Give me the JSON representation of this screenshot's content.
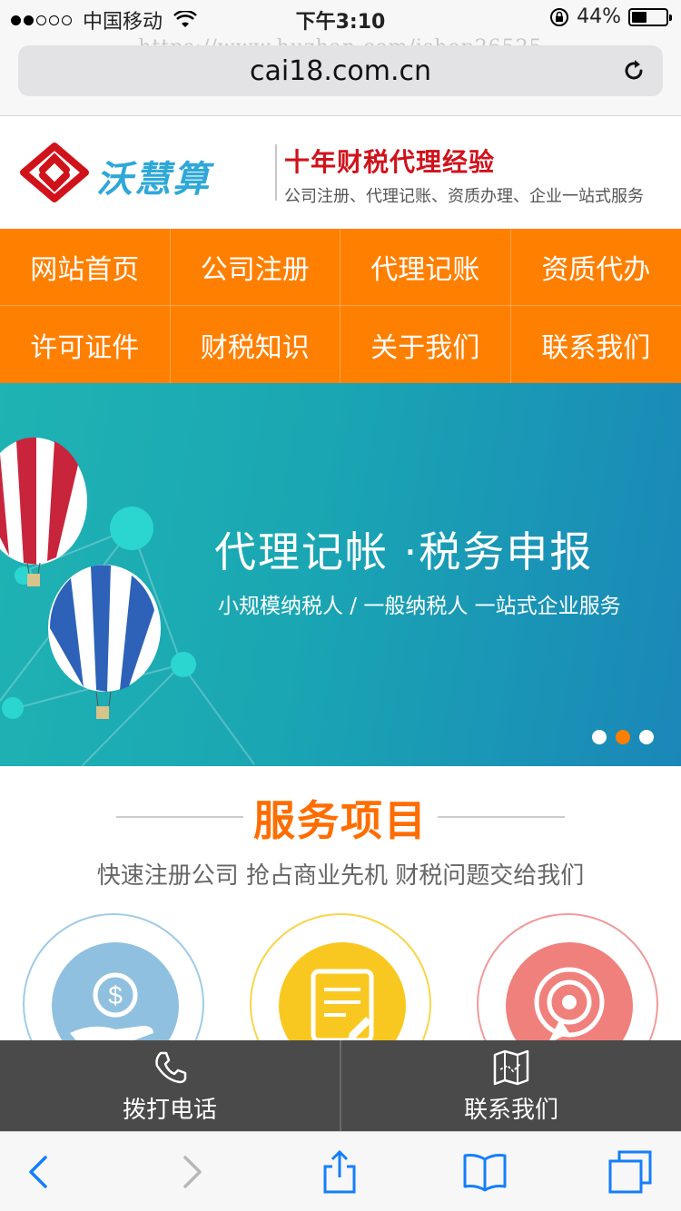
{
  "status_bar": {
    "carrier": "中国移动",
    "time": "下午3:10",
    "battery_percent": "44%",
    "battery_level": 0.44,
    "signal_dots_filled": 2,
    "signal_dots_total": 5
  },
  "browser": {
    "watermark": "https://www.huzhan.com/ishop26525",
    "url": "cai18.com.cn"
  },
  "header": {
    "logo_text": "沃慧算",
    "slogan": "十年财税代理经验",
    "services_line": "公司注册、代理记账、资质办理、企业一站式服务"
  },
  "nav": {
    "items": [
      {
        "label": "网站首页"
      },
      {
        "label": "公司注册"
      },
      {
        "label": "代理记账"
      },
      {
        "label": "资质代办"
      },
      {
        "label": "许可证件"
      },
      {
        "label": "财税知识"
      },
      {
        "label": "关于我们"
      },
      {
        "label": "联系我们"
      }
    ]
  },
  "banner": {
    "title": "代理记帐 ·税务申报",
    "subtitle": "小规模纳税人 / 一般纳税人   一站式企业服务",
    "slides_total": 3,
    "active_slide": 2
  },
  "services": {
    "title": "服务项目",
    "description": "快速注册公司 抢占商业先机 财税问题交给我们",
    "icons": [
      "money-hand-icon",
      "document-edit-icon",
      "target-icon"
    ]
  },
  "contact_bar": {
    "call_label": "拨打电话",
    "contact_label": "联系我们"
  },
  "colors": {
    "nav_orange": "#ff7f00",
    "slogan_red": "#d0121b",
    "logo_blue": "#2fa8d8",
    "services_title": "#ff6d00",
    "contact_bar": "#4a4a4a",
    "ios_blue": "#147efb"
  }
}
